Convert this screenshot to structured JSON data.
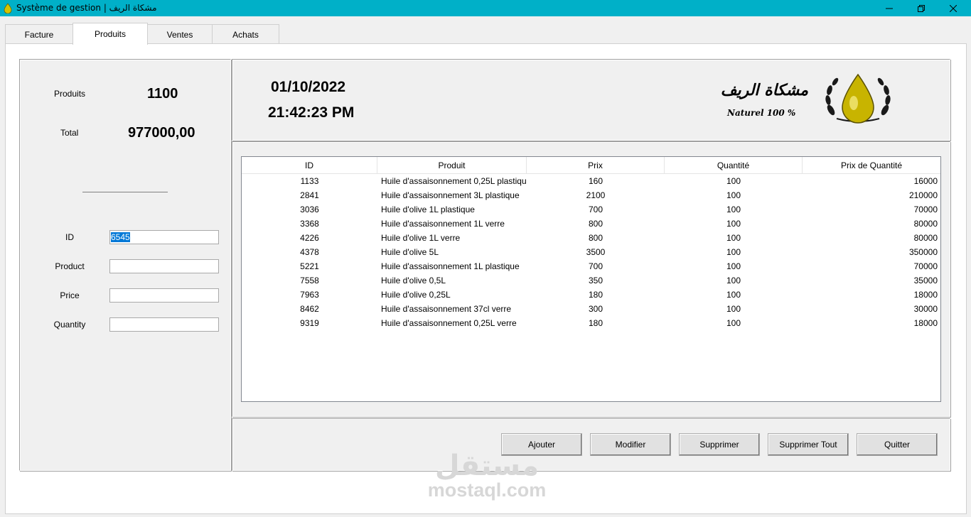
{
  "window": {
    "title": "Système de gestion | مشكاة الريف",
    "minimize_icon": "minimize-icon",
    "restore_icon": "restore-icon",
    "close_icon": "close-icon"
  },
  "tabs": [
    {
      "label": "Facture",
      "active": false
    },
    {
      "label": "Produits",
      "active": true
    },
    {
      "label": "Ventes",
      "active": false
    },
    {
      "label": "Achats",
      "active": false
    }
  ],
  "summary": {
    "products_label": "Produits",
    "products_value": "1100",
    "total_label": "Total",
    "total_value": "977000,00"
  },
  "form": {
    "id_label": "ID",
    "id_value": "6545",
    "product_label": "Product",
    "product_value": "",
    "price_label": "Price",
    "price_value": "",
    "quantity_label": "Quantity",
    "quantity_value": ""
  },
  "header": {
    "date": "01/10/2022",
    "time": "21:42:23 PM",
    "logo_text_ar": "مشكاة الريف",
    "logo_text_en": "Naturel 100 %"
  },
  "table": {
    "columns": [
      "ID",
      "Produit",
      "Prix",
      "Quantité",
      "Prix de Quantité"
    ],
    "rows": [
      [
        "1133",
        "Huile d'assaisonnement 0,25L plastiqu",
        "160",
        "100",
        "16000"
      ],
      [
        "2841",
        "Huile d'assaisonnement 3L plastique",
        "2100",
        "100",
        "210000"
      ],
      [
        "3036",
        "Huile d'olive 1L plastique",
        "700",
        "100",
        "70000"
      ],
      [
        "3368",
        "Huile d'assaisonnement 1L verre",
        "800",
        "100",
        "80000"
      ],
      [
        "4226",
        "Huile d'olive 1L verre",
        "800",
        "100",
        "80000"
      ],
      [
        "4378",
        "Huile d'olive 5L",
        "3500",
        "100",
        "350000"
      ],
      [
        "5221",
        "Huile d'assaisonnement 1L plastique",
        "700",
        "100",
        "70000"
      ],
      [
        "7558",
        "Huile d'olive 0,5L",
        "350",
        "100",
        "35000"
      ],
      [
        "7963",
        "Huile d'olive 0,25L",
        "180",
        "100",
        "18000"
      ],
      [
        "8462",
        "Huile d'assaisonnement 37cl verre",
        "300",
        "100",
        "30000"
      ],
      [
        "9319",
        "Huile d'assaisonnement 0,25L verre",
        "180",
        "100",
        "18000"
      ]
    ]
  },
  "buttons": {
    "add": "Ajouter",
    "edit": "Modifier",
    "delete": "Supprimer",
    "delete_all": "Supprimer Tout",
    "quit": "Quitter"
  },
  "watermark": {
    "ar": "مستقل",
    "en": "mostaql.com"
  },
  "colors": {
    "titlebar": "#00b0c8",
    "selection": "#0078d7",
    "logo_gold": "#c8b400"
  }
}
